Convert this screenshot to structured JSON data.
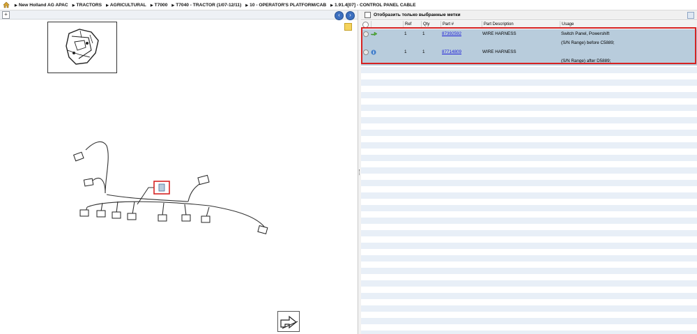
{
  "breadcrumb": {
    "items": [
      "New Holland AG APAC",
      "TRACTORS",
      "AGRICULTURAL",
      "T7000",
      "T7040 - TRACTOR (1/07-12/11)",
      "10 - OPERATOR'S PLATFORM/CAB",
      "1.91.4[07] - CONTROL PANEL CABLE"
    ]
  },
  "icons": {
    "home": "home-icon",
    "expand": "expand-icon",
    "prev": "arrow-left-icon",
    "next": "arrow-right-icon",
    "note": "note-icon",
    "export": "export-arrow-icon",
    "settings": "grid-settings-icon",
    "columns": "columns-icon",
    "row1_status": "green-arrow-icon",
    "row2_status": "blue-info-icon"
  },
  "filter": {
    "label": "Отобразить только выбранные метки",
    "checked": false
  },
  "grid": {
    "columns": [
      "",
      "",
      "Ref",
      "Qty",
      "Part #",
      "Part Description",
      "Usage"
    ],
    "rows": [
      {
        "ref": "1",
        "qty": "1",
        "part": "87392592",
        "description": "WIRE HARNESS",
        "usage": "Switch Panel, Powershift",
        "usage_note": "(S/N Range) before C5889;"
      },
      {
        "ref": "1",
        "qty": "1",
        "part": "87714809",
        "description": "WIRE HARNESS",
        "usage": "",
        "usage_note": "(S/N Range) after D5889;"
      }
    ]
  },
  "colors": {
    "selected_row": "#b8ccdc",
    "highlight_frame": "#d62222",
    "stripe": "#e8eff7",
    "link": "#1a1ad8",
    "nav_button": "#3c6fbf"
  }
}
